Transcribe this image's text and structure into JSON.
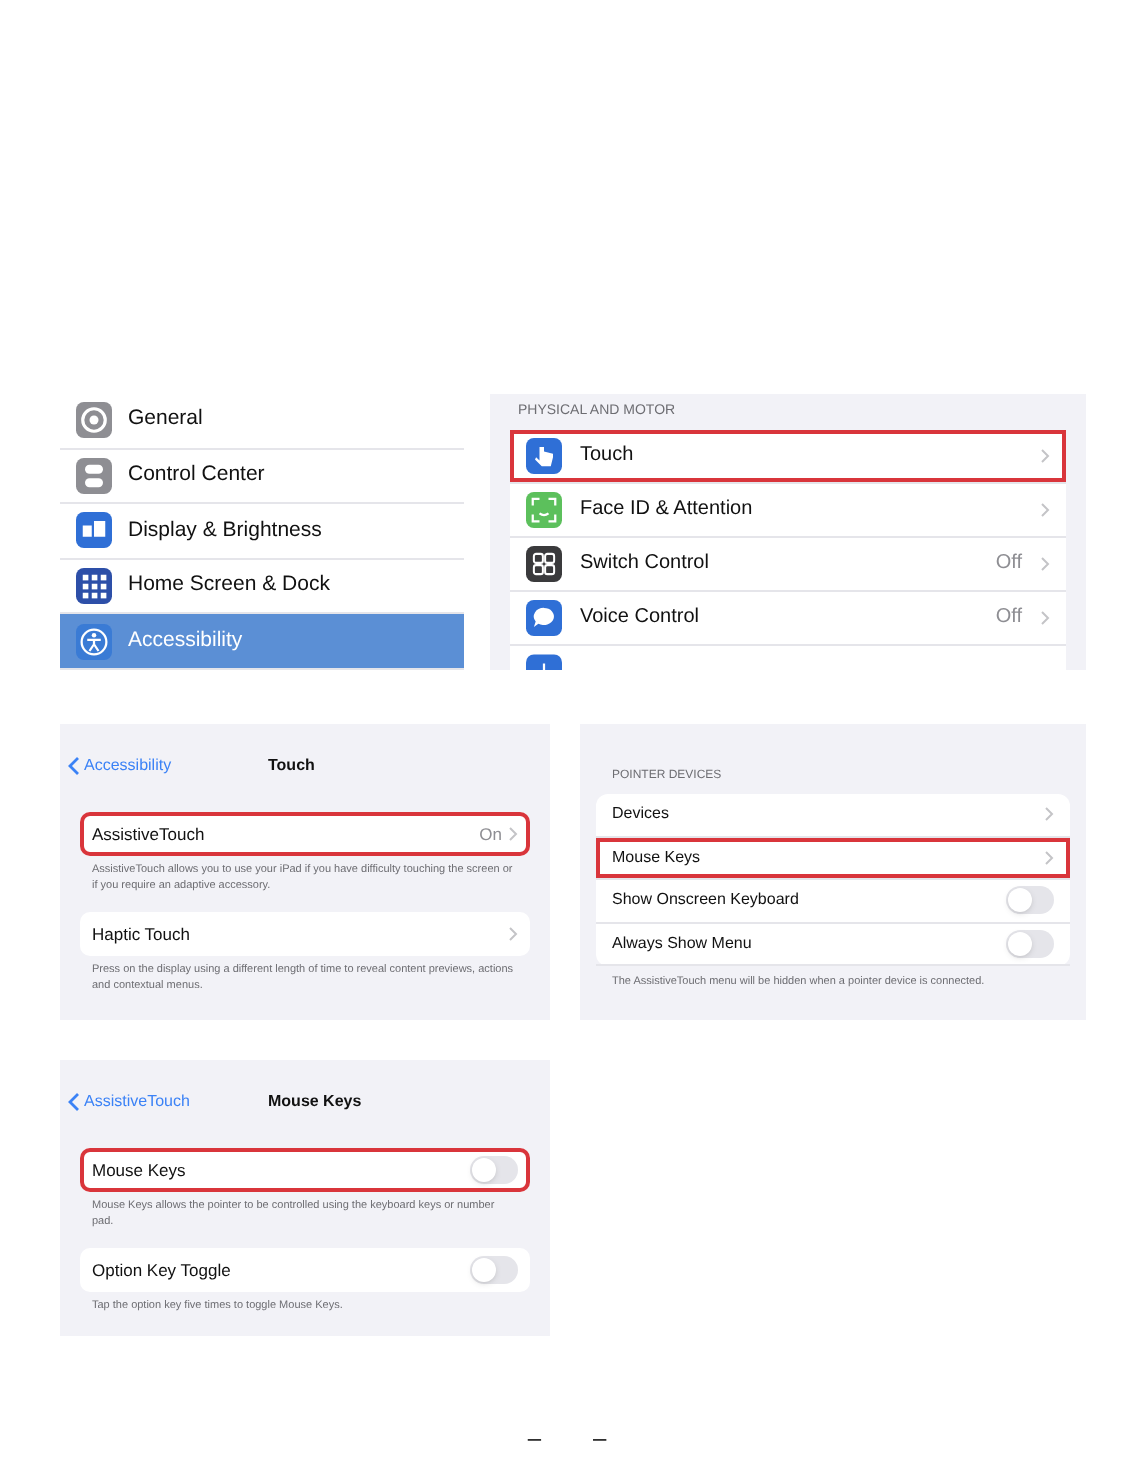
{
  "settings_sidebar": {
    "items": [
      {
        "label": "General",
        "selected": false
      },
      {
        "label": "Control Center",
        "selected": false
      },
      {
        "label": "Display & Brightness",
        "selected": false
      },
      {
        "label": "Home Screen & Dock",
        "selected": false
      },
      {
        "label": "Accessibility",
        "selected": true
      }
    ]
  },
  "physical_and_motor": {
    "header": "PHYSICAL AND MOTOR",
    "items": [
      {
        "label": "Touch",
        "value": null,
        "highlighted": true
      },
      {
        "label": "Face ID & Attention",
        "value": null,
        "highlighted": false
      },
      {
        "label": "Switch Control",
        "value": "Off",
        "highlighted": false
      },
      {
        "label": "Voice Control",
        "value": "Off",
        "highlighted": false
      }
    ]
  },
  "touch_screen": {
    "back": "Accessibility",
    "title": "Touch",
    "rows": [
      {
        "label": "AssistiveTouch",
        "value": "On",
        "highlighted": true,
        "footnote": "AssistiveTouch allows you to use your iPad if you have difficulty touching the screen or if you require an adaptive accessory."
      },
      {
        "label": "Haptic Touch",
        "value": null,
        "highlighted": false,
        "footnote": "Press on the display using a different length of time to reveal content previews, actions and contextual menus."
      }
    ]
  },
  "pointer_devices": {
    "header": "POINTER DEVICES",
    "rows": [
      {
        "label": "Devices",
        "kind": "link",
        "highlighted": false
      },
      {
        "label": "Mouse Keys",
        "kind": "link",
        "highlighted": true
      },
      {
        "label": "Show Onscreen Keyboard",
        "kind": "toggle",
        "on": false,
        "highlighted": false
      },
      {
        "label": "Always Show Menu",
        "kind": "toggle",
        "on": false,
        "highlighted": false
      }
    ],
    "footnote": "The AssistiveTouch menu will be hidden when a pointer device is connected."
  },
  "mouse_keys_screen": {
    "back": "AssistiveTouch",
    "title": "Mouse Keys",
    "rows": [
      {
        "label": "Mouse Keys",
        "on": false,
        "highlighted": true,
        "footnote": "Mouse Keys allows the pointer to be controlled using the keyboard keys or number pad."
      },
      {
        "label": "Option Key Toggle",
        "on": false,
        "highlighted": false,
        "footnote": "Tap the option key five times to toggle Mouse Keys."
      }
    ]
  },
  "page_marks": [
    "–",
    "–"
  ]
}
